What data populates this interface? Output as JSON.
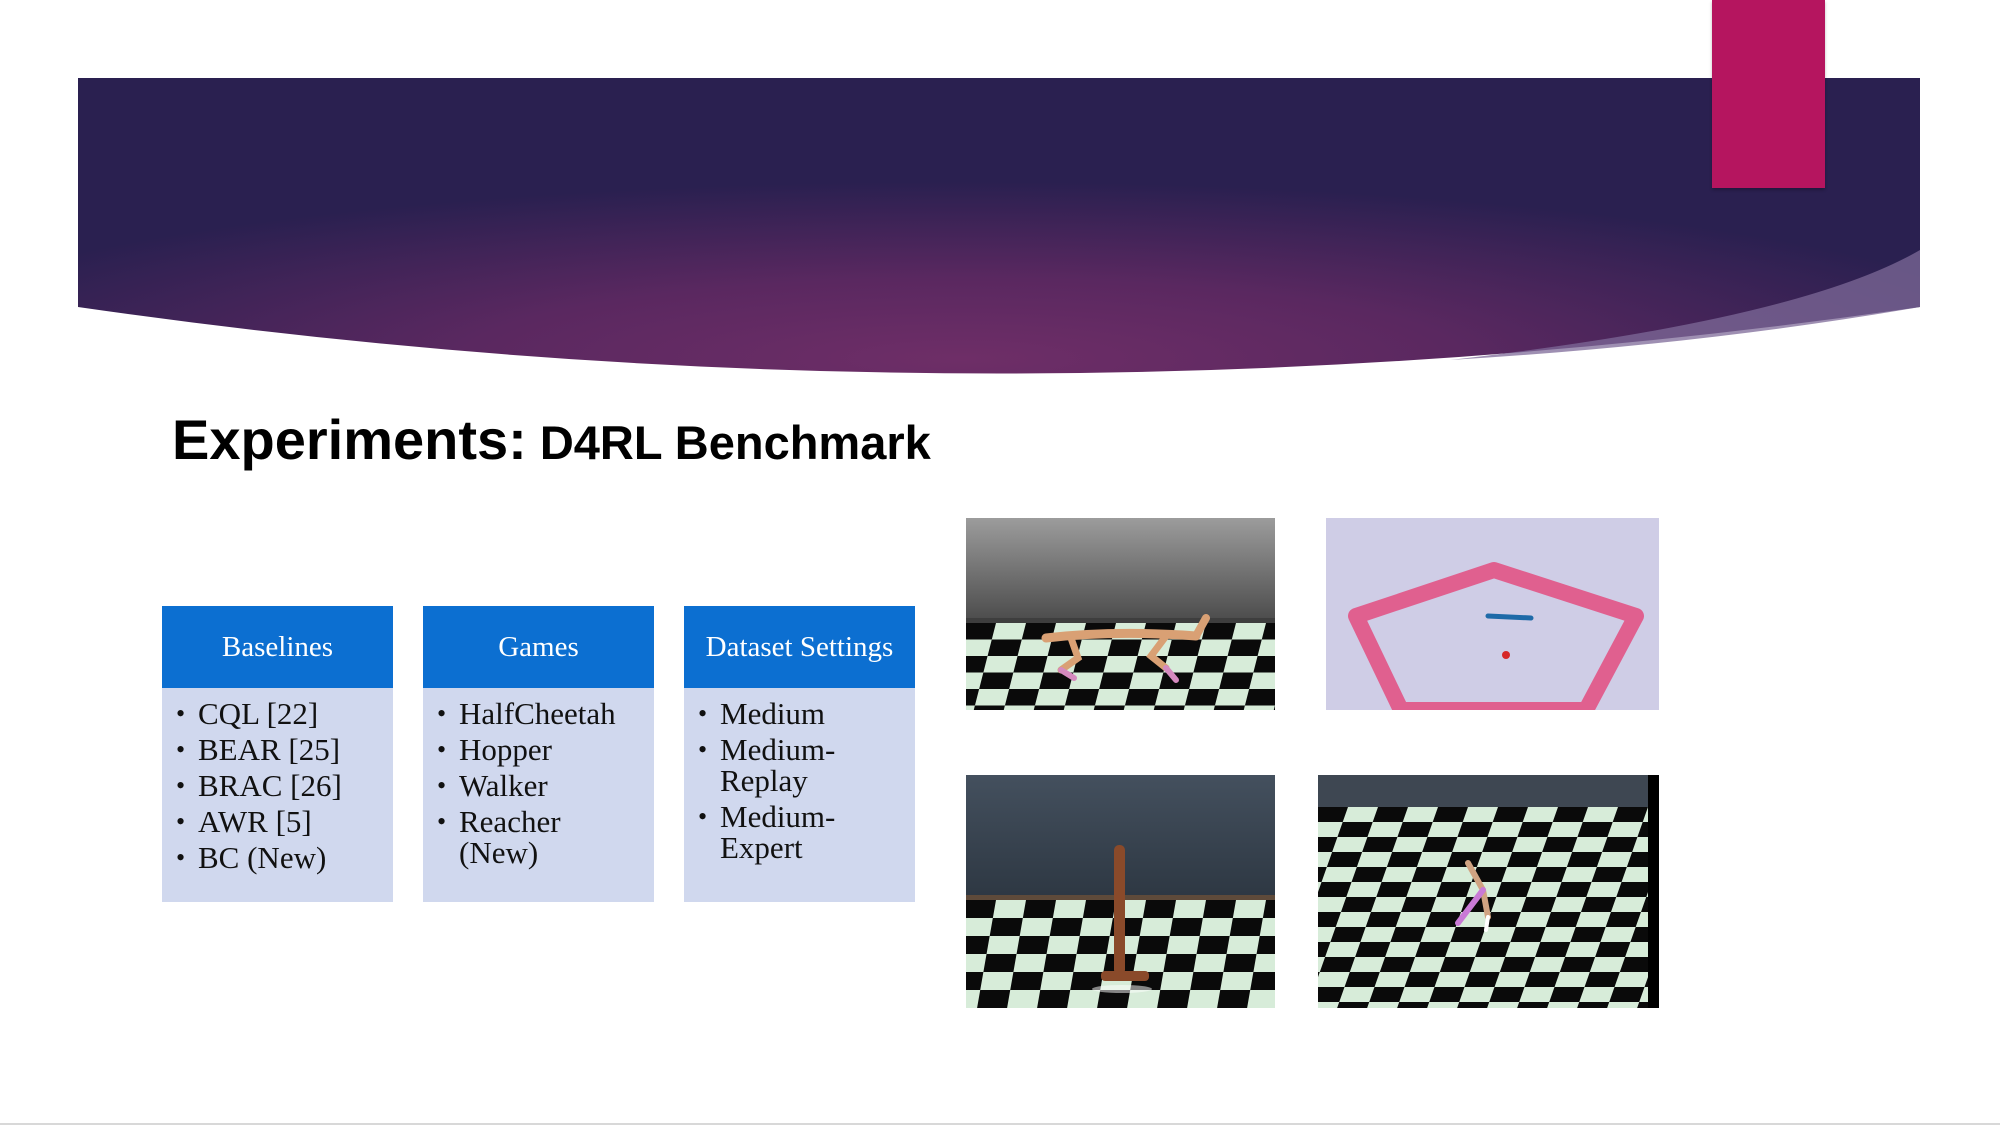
{
  "slide": {
    "title_main": "Experiments:",
    "title_sub": " D4RL Benchmark"
  },
  "columns": [
    {
      "header": "Baselines",
      "items": [
        "CQL [22]",
        "BEAR [25]",
        "BRAC [26]",
        "AWR [5]",
        "BC (New)"
      ]
    },
    {
      "header": "Games",
      "items": [
        "HalfCheetah",
        "Hopper",
        "Walker",
        "Reacher (New)"
      ]
    },
    {
      "header": "Dataset Settings",
      "items": [
        "Medium",
        "Medium-Replay",
        "Medium-Expert"
      ]
    }
  ],
  "images": [
    "halfcheetah-render",
    "reacher-render",
    "hopper-render",
    "walker-render"
  ],
  "colors": {
    "banner_purple": "#5e2a62",
    "banner_dark": "#2a2050",
    "accent_pink": "#b5155f",
    "column_header_blue": "#0c6fd1",
    "column_body": "#d0d8ee"
  }
}
